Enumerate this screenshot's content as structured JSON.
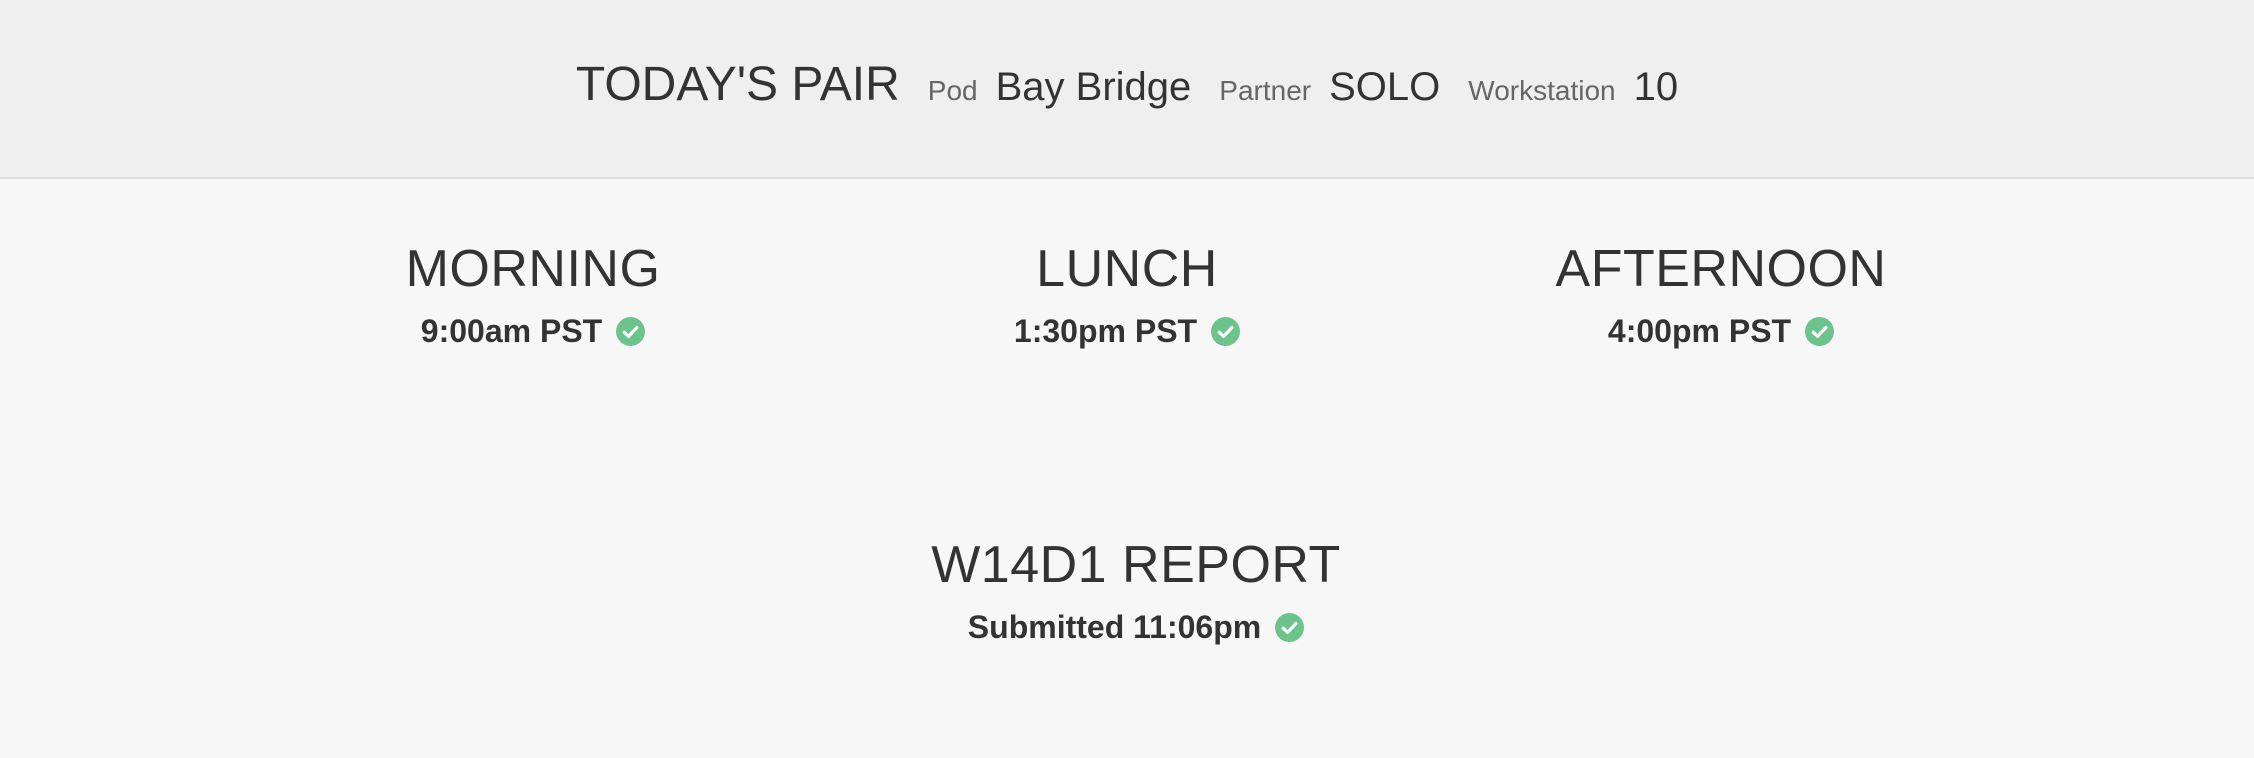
{
  "pair": {
    "title": "TODAY'S PAIR",
    "pod_label": "Pod",
    "pod_value": "Bay Bridge",
    "partner_label": "Partner",
    "partner_value": "SOLO",
    "workstation_label": "Workstation",
    "workstation_value": "10"
  },
  "checkins": {
    "morning": {
      "title": "MORNING",
      "time": "9:00am PST",
      "icon": "check-circle-icon"
    },
    "lunch": {
      "title": "LUNCH",
      "time": "1:30pm PST",
      "icon": "check-circle-icon"
    },
    "afternoon": {
      "title": "AFTERNOON",
      "time": "4:00pm PST",
      "icon": "check-circle-icon"
    }
  },
  "report": {
    "title": "W14D1 REPORT",
    "status": "Submitted 11:06pm",
    "icon": "check-circle-icon"
  },
  "colors": {
    "check_green": "#6cc38c",
    "header_bg": "#efefef",
    "page_bg": "#f7f7f7",
    "text_dark": "#333333",
    "text_muted": "#666666"
  }
}
